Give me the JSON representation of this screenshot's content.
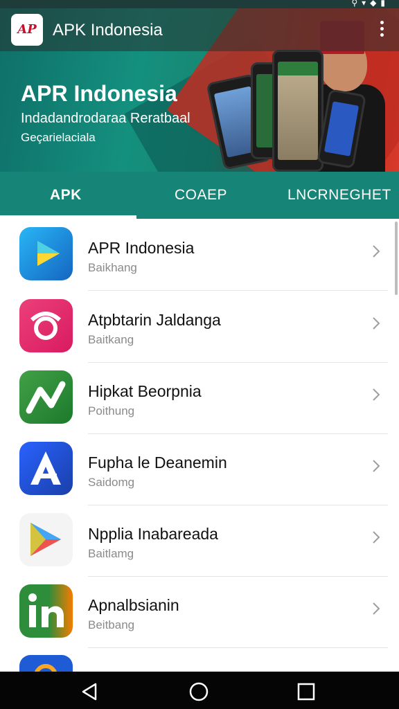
{
  "app_bar": {
    "title": "APK Indonesia",
    "logo_text": "AP"
  },
  "banner": {
    "title": "APR Indonesia",
    "line1": "Indadandrodaraa Reratbaal",
    "line2": "Geçarielaciala"
  },
  "tabs": [
    {
      "label": "APK",
      "selected": true
    },
    {
      "label": "COAEP",
      "selected": false
    },
    {
      "label": "LNCRNEGHET",
      "selected": false
    }
  ],
  "list": {
    "items": [
      {
        "title": "APR Indonesia",
        "subtitle": "Baikhang",
        "icon": "play-triangle-icon",
        "color": "#2196f3"
      },
      {
        "title": "Atpbtarin Jaldanga",
        "subtitle": "Baitkang",
        "icon": "ring-icon",
        "color": "#e91e63"
      },
      {
        "title": "Hipkat Beorpnia",
        "subtitle": "Poithung",
        "icon": "zigzag-n-icon",
        "color": "#2e9d3a"
      },
      {
        "title": "Fupha le Deanemin",
        "subtitle": "Saidomg",
        "icon": "letter-a-icon",
        "color": "#1a4fc4"
      },
      {
        "title": "Npplia Inabareada",
        "subtitle": "Baitlamg",
        "icon": "play-store-icon",
        "color": "#f5f5f5"
      },
      {
        "title": "Apnalbsianin",
        "subtitle": "Beitbang",
        "icon": "in-icon",
        "color": "#2e8d3a"
      },
      {
        "title": "",
        "subtitle": "",
        "icon": "partial-app-icon",
        "color": "#1e5bd4"
      }
    ]
  },
  "colors": {
    "header_teal": "#14907f",
    "tab_bar": "#168476",
    "accent_red": "#c12d22"
  }
}
